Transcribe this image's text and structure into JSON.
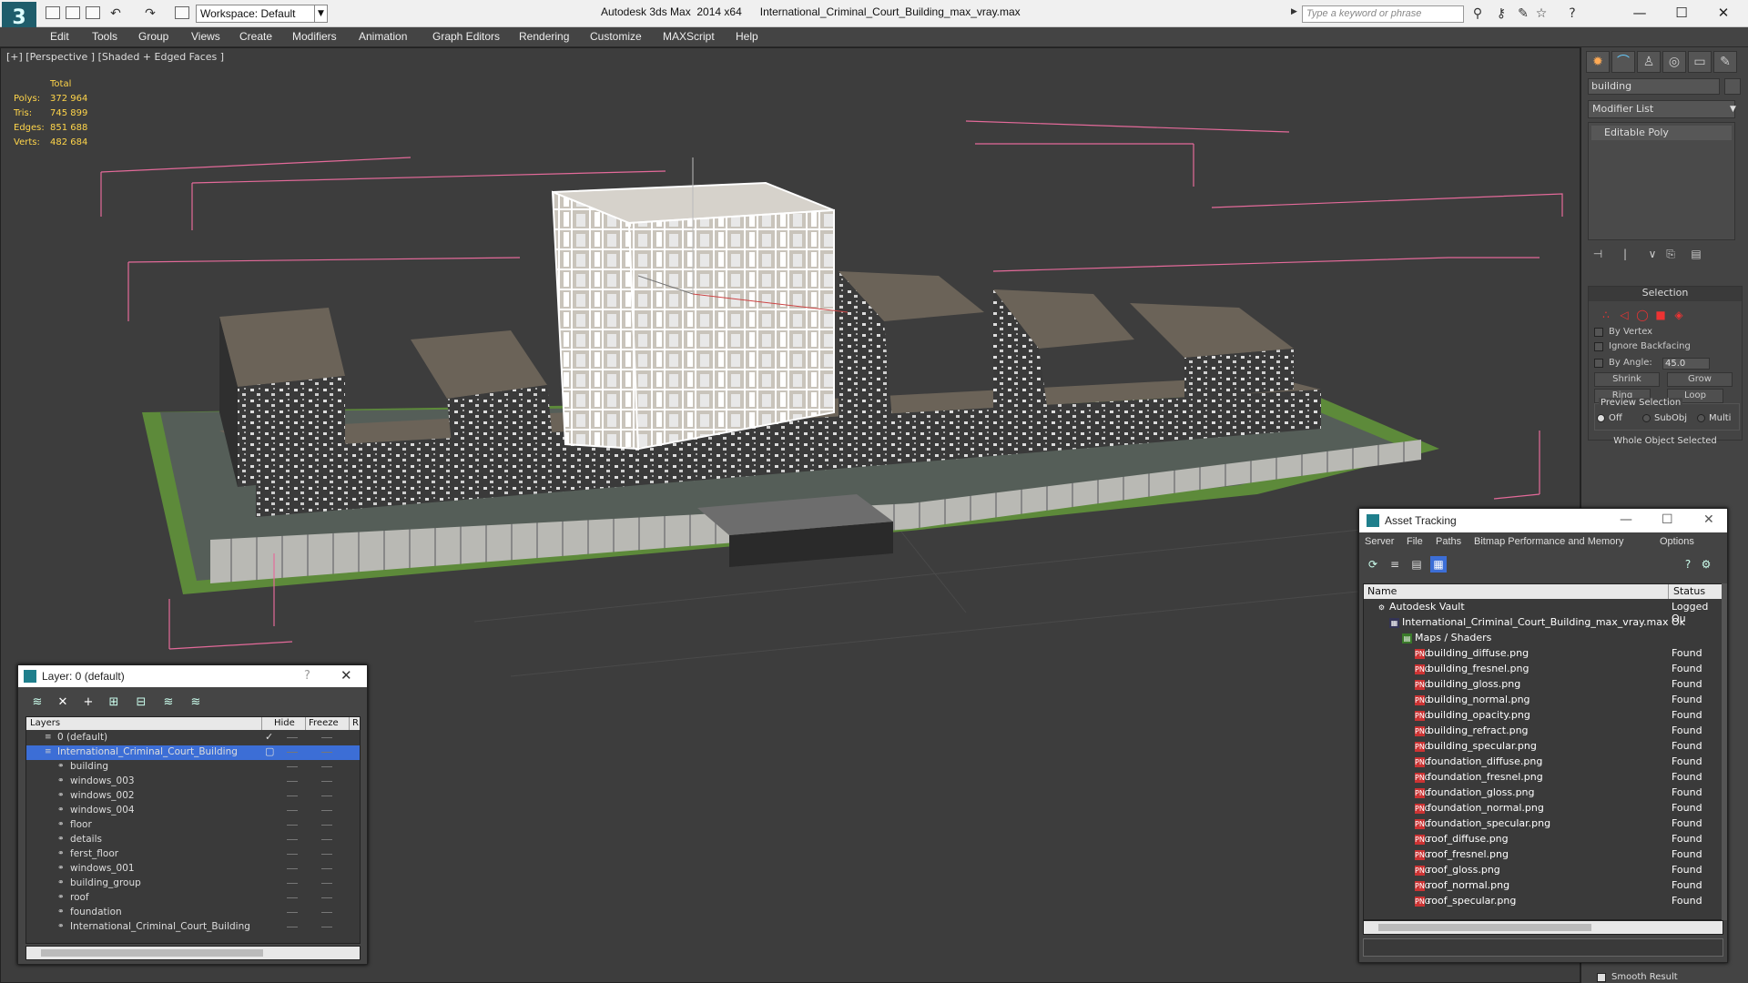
{
  "titlebar": {
    "workspace": "Workspace: Default",
    "title": "Autodesk 3ds Max  2014 x64      International_Criminal_Court_Building_max_vray.max",
    "search_placeholder": "Type a keyword or phrase"
  },
  "menu": [
    "Edit",
    "Tools",
    "Group",
    "Views",
    "Create",
    "Modifiers",
    "Animation",
    "Graph Editors",
    "Rendering",
    "Customize",
    "MAXScript",
    "Help"
  ],
  "viewport": {
    "label": "[+] [Perspective ] [Shaded + Edged Faces ]",
    "stats_header": "Total",
    "stats": [
      {
        "k": "Polys:",
        "v": "372 964"
      },
      {
        "k": "Tris:",
        "v": "745 899"
      },
      {
        "k": "Edges:",
        "v": "851 688"
      },
      {
        "k": "Verts:",
        "v": "482 684"
      }
    ]
  },
  "cmdpanel": {
    "object_name": "building",
    "modifier_list": "Modifier List",
    "stack_item": "Editable Poly",
    "selection_title": "Selection",
    "by_vertex": "By Vertex",
    "ignore_backfacing": "Ignore Backfacing",
    "by_angle": "By Angle:",
    "angle_value": "45.0",
    "shrink": "Shrink",
    "grow": "Grow",
    "ring": "Ring",
    "loop": "Loop",
    "preview_selection": "Preview Selection",
    "off": "Off",
    "subobj": "SubObj",
    "multi": "Multi",
    "whole_object": "Whole Object Selected",
    "smooth_result": "Smooth Result"
  },
  "layer_dialog": {
    "title": "Layer: 0 (default)",
    "help": "?",
    "col_layers": "Layers",
    "col_hide": "Hide",
    "col_freeze": "Freeze",
    "col_r": "R",
    "rows": [
      {
        "name": "0 (default)",
        "indent": 0,
        "type": "layer",
        "active": true
      },
      {
        "name": "International_Criminal_Court_Building",
        "indent": 0,
        "type": "layer",
        "selected": true
      },
      {
        "name": "building",
        "indent": 1,
        "type": "object"
      },
      {
        "name": "windows_003",
        "indent": 1,
        "type": "object"
      },
      {
        "name": "windows_002",
        "indent": 1,
        "type": "object"
      },
      {
        "name": "windows_004",
        "indent": 1,
        "type": "object"
      },
      {
        "name": "floor",
        "indent": 1,
        "type": "object"
      },
      {
        "name": "details",
        "indent": 1,
        "type": "object"
      },
      {
        "name": "ferst_floor",
        "indent": 1,
        "type": "object"
      },
      {
        "name": "windows_001",
        "indent": 1,
        "type": "object"
      },
      {
        "name": "building_group",
        "indent": 1,
        "type": "object"
      },
      {
        "name": "roof",
        "indent": 1,
        "type": "object"
      },
      {
        "name": "foundation",
        "indent": 1,
        "type": "object"
      },
      {
        "name": "International_Criminal_Court_Building",
        "indent": 1,
        "type": "object"
      }
    ]
  },
  "asset_dialog": {
    "title": "Asset Tracking",
    "menu": [
      "Server",
      "File",
      "Paths",
      "Bitmap Performance and Memory",
      "Options"
    ],
    "col_name": "Name",
    "col_status": "Status",
    "rows": [
      {
        "name": "Autodesk Vault",
        "status": "Logged Ou",
        "indent": 1,
        "icon": "vault"
      },
      {
        "name": "International_Criminal_Court_Building_max_vray.max",
        "status": "Ok",
        "indent": 2,
        "icon": "max"
      },
      {
        "name": "Maps / Shaders",
        "status": "",
        "indent": 3,
        "icon": "folder"
      },
      {
        "name": "building_diffuse.png",
        "status": "Found",
        "indent": 4,
        "icon": "png"
      },
      {
        "name": "building_fresnel.png",
        "status": "Found",
        "indent": 4,
        "icon": "png"
      },
      {
        "name": "building_gloss.png",
        "status": "Found",
        "indent": 4,
        "icon": "png"
      },
      {
        "name": "building_normal.png",
        "status": "Found",
        "indent": 4,
        "icon": "png"
      },
      {
        "name": "building_opacity.png",
        "status": "Found",
        "indent": 4,
        "icon": "png"
      },
      {
        "name": "building_refract.png",
        "status": "Found",
        "indent": 4,
        "icon": "png"
      },
      {
        "name": "building_specular.png",
        "status": "Found",
        "indent": 4,
        "icon": "png"
      },
      {
        "name": "foundation_diffuse.png",
        "status": "Found",
        "indent": 4,
        "icon": "png"
      },
      {
        "name": "foundation_fresnel.png",
        "status": "Found",
        "indent": 4,
        "icon": "png"
      },
      {
        "name": "foundation_gloss.png",
        "status": "Found",
        "indent": 4,
        "icon": "png"
      },
      {
        "name": "foundation_normal.png",
        "status": "Found",
        "indent": 4,
        "icon": "png"
      },
      {
        "name": "foundation_specular.png",
        "status": "Found",
        "indent": 4,
        "icon": "png"
      },
      {
        "name": "roof_diffuse.png",
        "status": "Found",
        "indent": 4,
        "icon": "png"
      },
      {
        "name": "roof_fresnel.png",
        "status": "Found",
        "indent": 4,
        "icon": "png"
      },
      {
        "name": "roof_gloss.png",
        "status": "Found",
        "indent": 4,
        "icon": "png"
      },
      {
        "name": "roof_normal.png",
        "status": "Found",
        "indent": 4,
        "icon": "png"
      },
      {
        "name": "roof_specular.png",
        "status": "Found",
        "indent": 4,
        "icon": "png"
      }
    ]
  },
  "colors": {
    "stats": "#ffd54a",
    "selection_bbox": "#e46a9a",
    "layer_selected": "#3c6ed6",
    "viewport_bg": "#3d3d3d"
  }
}
